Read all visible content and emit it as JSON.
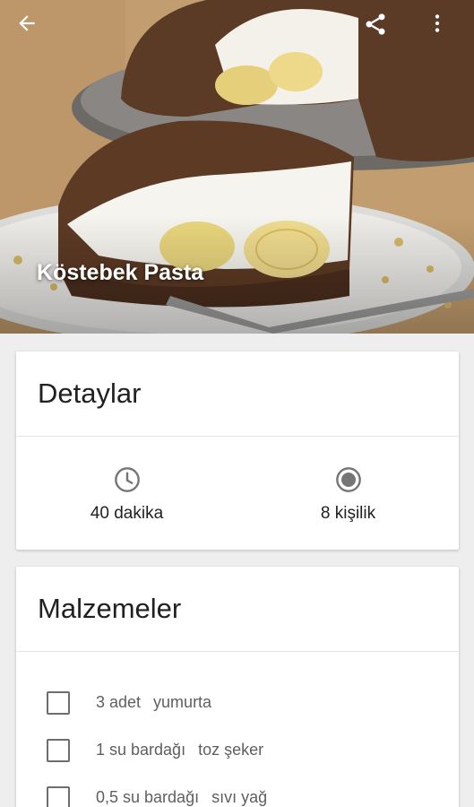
{
  "hero": {
    "title": "Köstebek Pasta",
    "icons": {
      "back": "arrow-back-icon",
      "share": "share-icon",
      "more": "more-vert-icon"
    }
  },
  "details": {
    "title": "Detaylar",
    "time": {
      "icon": "clock-icon",
      "text": "40 dakika"
    },
    "servings": {
      "icon": "radio-dot-icon",
      "text": "8 kişilik"
    }
  },
  "ingredients": {
    "title": "Malzemeler",
    "items": [
      {
        "amount": "3 adet",
        "name": "yumurta",
        "checked": false
      },
      {
        "amount": "1 su bardağı",
        "name": "toz şeker",
        "checked": false
      },
      {
        "amount": "0,5 su bardağı",
        "name": "sıvı yağ",
        "checked": false
      }
    ]
  },
  "colors": {
    "background": "#eeeeee",
    "card": "#ffffff",
    "text_primary": "#212121",
    "text_secondary": "#5f5f5f",
    "icon_gray": "#757575"
  }
}
